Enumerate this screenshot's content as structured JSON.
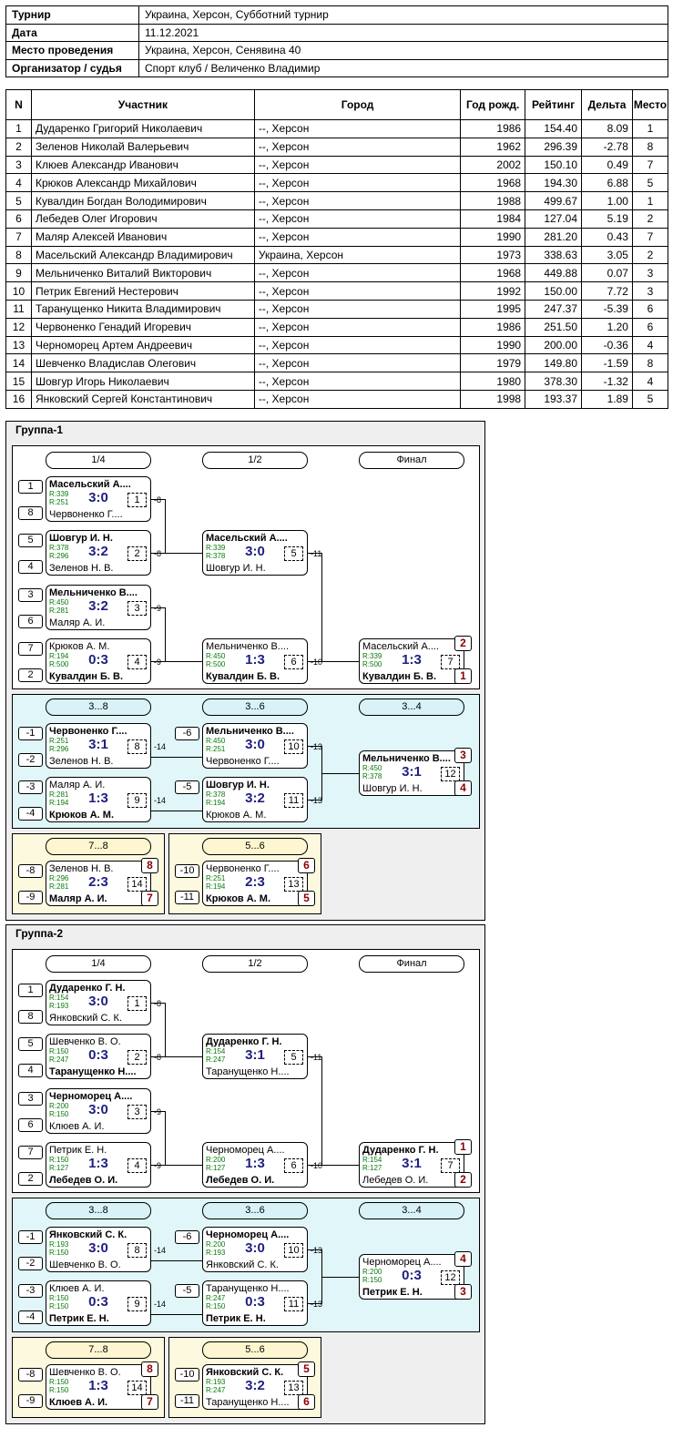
{
  "info": [
    {
      "k": "Турнир",
      "v": "Украина, Херсон, Субботний турнир"
    },
    {
      "k": "Дата",
      "v": "11.12.2021"
    },
    {
      "k": "Место проведения",
      "v": "Украина, Херсон, Сенявина 40"
    },
    {
      "k": "Организатор / судья",
      "v": "Спорт клуб / Величенко Владимир"
    }
  ],
  "players_header": [
    "N",
    "Участник",
    "Город",
    "Год рожд.",
    "Рейтинг",
    "Дельта",
    "Место"
  ],
  "players": [
    [
      "1",
      "Дударенко Григорий Николаевич",
      "--, Херсон",
      "1986",
      "154.40",
      "8.09",
      "1"
    ],
    [
      "2",
      "Зеленов Николай Валерьевич",
      "--, Херсон",
      "1962",
      "296.39",
      "-2.78",
      "8"
    ],
    [
      "3",
      "Клюев Александр Иванович",
      "--, Херсон",
      "2002",
      "150.10",
      "0.49",
      "7"
    ],
    [
      "4",
      "Крюков Александр Михайлович",
      "--, Херсон",
      "1968",
      "194.30",
      "6.88",
      "5"
    ],
    [
      "5",
      "Кувалдин Богдан Володимирович",
      "--, Херсон",
      "1988",
      "499.67",
      "1.00",
      "1"
    ],
    [
      "6",
      "Лебедев Олег Игорович",
      "--, Херсон",
      "1984",
      "127.04",
      "5.19",
      "2"
    ],
    [
      "7",
      "Маляр Алексей Иванович",
      "--, Херсон",
      "1990",
      "281.20",
      "0.43",
      "7"
    ],
    [
      "8",
      "Масельский Александр Владимирович",
      "Украина, Херсон",
      "1973",
      "338.63",
      "3.05",
      "2"
    ],
    [
      "9",
      "Мельниченко Виталий Викторович",
      "--, Херсон",
      "1968",
      "449.88",
      "0.07",
      "3"
    ],
    [
      "10",
      "Петрик Евгений Нестерович",
      "--, Херсон",
      "1992",
      "150.00",
      "7.72",
      "3"
    ],
    [
      "11",
      "Таранущенко Никита Владимирович",
      "--, Херсон",
      "1995",
      "247.37",
      "-5.39",
      "6"
    ],
    [
      "12",
      "Червоненко Генадий Игоревич",
      "--, Херсон",
      "1986",
      "251.50",
      "1.20",
      "6"
    ],
    [
      "13",
      "Черноморец Артем Андреевич",
      "--, Херсон",
      "1990",
      "200.00",
      "-0.36",
      "4"
    ],
    [
      "14",
      "Шевченко Владислав Олегович",
      "--, Херсон",
      "1979",
      "149.80",
      "-1.59",
      "8"
    ],
    [
      "15",
      "Шовгур Игорь Николаевич",
      "--, Херсон",
      "1980",
      "378.30",
      "-1.32",
      "4"
    ],
    [
      "16",
      "Янковский Сергей Константинович",
      "--, Херсон",
      "1998",
      "193.37",
      "1.89",
      "5"
    ]
  ],
  "groups": [
    {
      "title": "Группа-1",
      "rounds_main": [
        "1/4",
        "1/2",
        "Финал"
      ],
      "rounds_cons": [
        "3...8",
        "3...6",
        "3...4"
      ],
      "round_78": "7...8",
      "round_56": "5...6",
      "matches": [
        {
          "p1": "Масельский А....",
          "p2": "Червоненко Г....",
          "r1": "R:339",
          "r2": "R:251",
          "score": "3:0",
          "no": "1",
          "win": 1,
          "s1": "1",
          "s2": "8",
          "link": "-8"
        },
        {
          "p1": "Шовгур И. Н.",
          "p2": "Зеленов Н. В.",
          "r1": "R:378",
          "r2": "R:296",
          "score": "3:2",
          "no": "2",
          "win": 1,
          "s1": "5",
          "s2": "4",
          "link": "-8"
        },
        {
          "p1": "Мельниченко В....",
          "p2": "Маляр А. И.",
          "r1": "R:450",
          "r2": "R:281",
          "score": "3:2",
          "no": "3",
          "win": 1,
          "s1": "3",
          "s2": "6",
          "link": "-9"
        },
        {
          "p1": "Крюков А. М.",
          "p2": "Кувалдин Б. В.",
          "r1": "R:194",
          "r2": "R:500",
          "score": "0:3",
          "no": "4",
          "win": 2,
          "s1": "7",
          "s2": "2",
          "link": "-9"
        },
        {
          "p1": "Масельский А....",
          "p2": "Шовгур И. Н.",
          "r1": "R:339",
          "r2": "R:378",
          "score": "3:0",
          "no": "5",
          "win": 1,
          "link": "-11"
        },
        {
          "p1": "Мельниченко В....",
          "p2": "Кувалдин Б. В.",
          "r1": "R:450",
          "r2": "R:500",
          "score": "1:3",
          "no": "6",
          "win": 2,
          "link": "-10"
        },
        {
          "p1": "Масельский А....",
          "p2": "Кувалдин Б. В.",
          "r1": "R:339",
          "r2": "R:500",
          "score": "1:3",
          "no": "7",
          "win": 2,
          "pl1": "2",
          "pl2": "1"
        },
        {
          "p1": "Червоненко Г....",
          "p2": "Зеленов Н. В.",
          "r1": "R:251",
          "r2": "R:296",
          "score": "3:1",
          "no": "8",
          "win": 1,
          "s1": "-1",
          "s2": "-2",
          "link": "-14"
        },
        {
          "p1": "Маляр А. И.",
          "p2": "Крюков А. М.",
          "r1": "R:281",
          "r2": "R:194",
          "score": "1:3",
          "no": "9",
          "win": 2,
          "s1": "-3",
          "s2": "-4",
          "link": "-14"
        },
        {
          "p1": "Мельниченко В....",
          "p2": "Червоненко Г....",
          "r1": "R:450",
          "r2": "R:251",
          "score": "3:0",
          "no": "10",
          "win": 1,
          "s1": "-6",
          "link": "-13"
        },
        {
          "p1": "Шовгур И. Н.",
          "p2": "Крюков А. М.",
          "r1": "R:378",
          "r2": "R:194",
          "score": "3:2",
          "no": "11",
          "win": 1,
          "s1": "-5",
          "link": "-13"
        },
        {
          "p1": "Мельниченко В....",
          "p2": "Шовгур И. Н.",
          "r1": "R:450",
          "r2": "R:378",
          "score": "3:1",
          "no": "12",
          "win": 1,
          "pl1": "3",
          "pl2": "4"
        },
        {
          "p1": "Зеленов Н. В.",
          "p2": "Маляр А. И.",
          "r1": "R:296",
          "r2": "R:281",
          "score": "2:3",
          "no": "14",
          "win": 2,
          "s1": "-8",
          "s2": "-9",
          "pl1": "8",
          "pl2": "7"
        },
        {
          "p1": "Червоненко Г....",
          "p2": "Крюков А. М.",
          "r1": "R:251",
          "r2": "R:194",
          "score": "2:3",
          "no": "13",
          "win": 2,
          "s1": "-10",
          "s2": "-11",
          "pl1": "6",
          "pl2": "5"
        }
      ]
    },
    {
      "title": "Группа-2",
      "rounds_main": [
        "1/4",
        "1/2",
        "Финал"
      ],
      "rounds_cons": [
        "3...8",
        "3...6",
        "3...4"
      ],
      "round_78": "7...8",
      "round_56": "5...6",
      "matches": [
        {
          "p1": "Дударенко Г. Н.",
          "p2": "Янковский С. К.",
          "r1": "R:154",
          "r2": "R:193",
          "score": "3:0",
          "no": "1",
          "win": 1,
          "s1": "1",
          "s2": "8",
          "link": "-8"
        },
        {
          "p1": "Шевченко В. О.",
          "p2": "Таранущенко Н....",
          "r1": "R:150",
          "r2": "R:247",
          "score": "0:3",
          "no": "2",
          "win": 2,
          "s1": "5",
          "s2": "4",
          "link": "-8"
        },
        {
          "p1": "Черноморец А....",
          "p2": "Клюев А. И.",
          "r1": "R:200",
          "r2": "R:150",
          "score": "3:0",
          "no": "3",
          "win": 1,
          "s1": "3",
          "s2": "6",
          "link": "-9"
        },
        {
          "p1": "Петрик Е. Н.",
          "p2": "Лебедев О. И.",
          "r1": "R:150",
          "r2": "R:127",
          "score": "1:3",
          "no": "4",
          "win": 2,
          "s1": "7",
          "s2": "2",
          "link": "-9"
        },
        {
          "p1": "Дударенко Г. Н.",
          "p2": "Таранущенко Н....",
          "r1": "R:154",
          "r2": "R:247",
          "score": "3:1",
          "no": "5",
          "win": 1,
          "link": "-11"
        },
        {
          "p1": "Черноморец А....",
          "p2": "Лебедев О. И.",
          "r1": "R:200",
          "r2": "R:127",
          "score": "1:3",
          "no": "6",
          "win": 2,
          "link": "-10"
        },
        {
          "p1": "Дударенко Г. Н.",
          "p2": "Лебедев О. И.",
          "r1": "R:154",
          "r2": "R:127",
          "score": "3:1",
          "no": "7",
          "win": 1,
          "pl1": "1",
          "pl2": "2"
        },
        {
          "p1": "Янковский С. К.",
          "p2": "Шевченко В. О.",
          "r1": "R:193",
          "r2": "R:150",
          "score": "3:0",
          "no": "8",
          "win": 1,
          "s1": "-1",
          "s2": "-2",
          "link": "-14"
        },
        {
          "p1": "Клюев А. И.",
          "p2": "Петрик Е. Н.",
          "r1": "R:150",
          "r2": "R:150",
          "score": "0:3",
          "no": "9",
          "win": 2,
          "s1": "-3",
          "s2": "-4",
          "link": "-14"
        },
        {
          "p1": "Черноморец А....",
          "p2": "Янковский С. К.",
          "r1": "R:200",
          "r2": "R:193",
          "score": "3:0",
          "no": "10",
          "win": 1,
          "s1": "-6",
          "link": "-13"
        },
        {
          "p1": "Таранущенко Н....",
          "p2": "Петрик Е. Н.",
          "r1": "R:247",
          "r2": "R:150",
          "score": "0:3",
          "no": "11",
          "win": 2,
          "s1": "-5",
          "link": "-13"
        },
        {
          "p1": "Черноморец А....",
          "p2": "Петрик Е. Н.",
          "r1": "R:200",
          "r2": "R:150",
          "score": "0:3",
          "no": "12",
          "win": 2,
          "pl1": "4",
          "pl2": "3"
        },
        {
          "p1": "Шевченко В. О.",
          "p2": "Клюев А. И.",
          "r1": "R:150",
          "r2": "R:150",
          "score": "1:3",
          "no": "14",
          "win": 2,
          "s1": "-8",
          "s2": "-9",
          "pl1": "8",
          "pl2": "7"
        },
        {
          "p1": "Янковский С. К.",
          "p2": "Таранущенко Н....",
          "r1": "R:193",
          "r2": "R:247",
          "score": "3:2",
          "no": "13",
          "win": 1,
          "s1": "-10",
          "s2": "-11",
          "pl1": "5",
          "pl2": "6"
        }
      ]
    }
  ]
}
